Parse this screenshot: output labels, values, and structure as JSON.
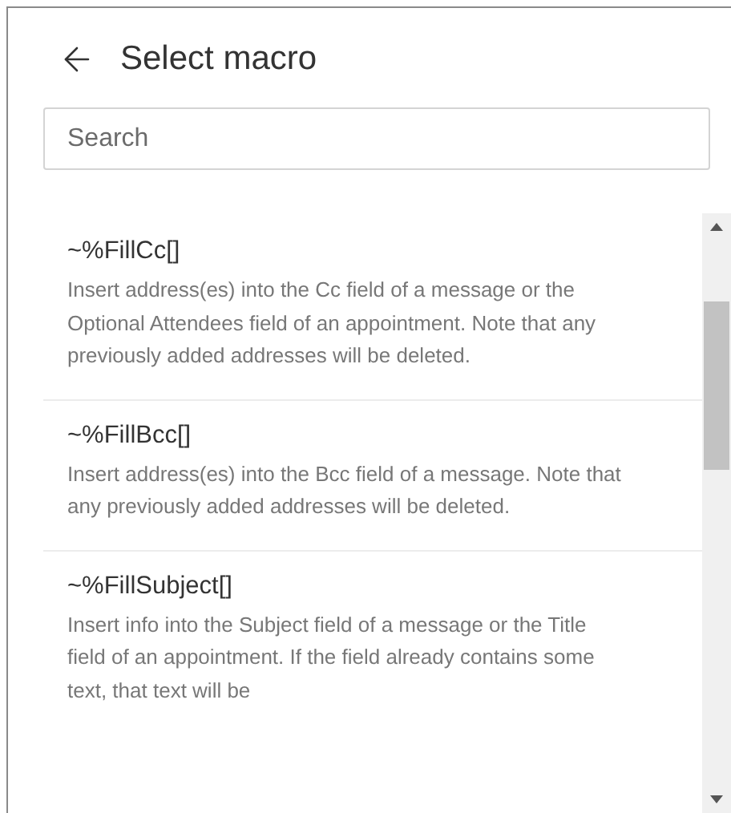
{
  "header": {
    "title": "Select macro"
  },
  "search": {
    "placeholder": "Search"
  },
  "macros": [
    {
      "name": "~%FillCc[]",
      "description": "Insert address(es) into the Cc field of a message or the Optional Attendees field of an appointment. Note that any previously added addresses will be deleted."
    },
    {
      "name": "~%FillBcc[]",
      "description": "Insert address(es) into the Bcc field of a message. Note that any previously added addresses will be deleted."
    },
    {
      "name": "~%FillSubject[]",
      "description": "Insert info into the Subject field of a message or the Title field of an appointment. If the field already contains some text, that text will be"
    }
  ]
}
